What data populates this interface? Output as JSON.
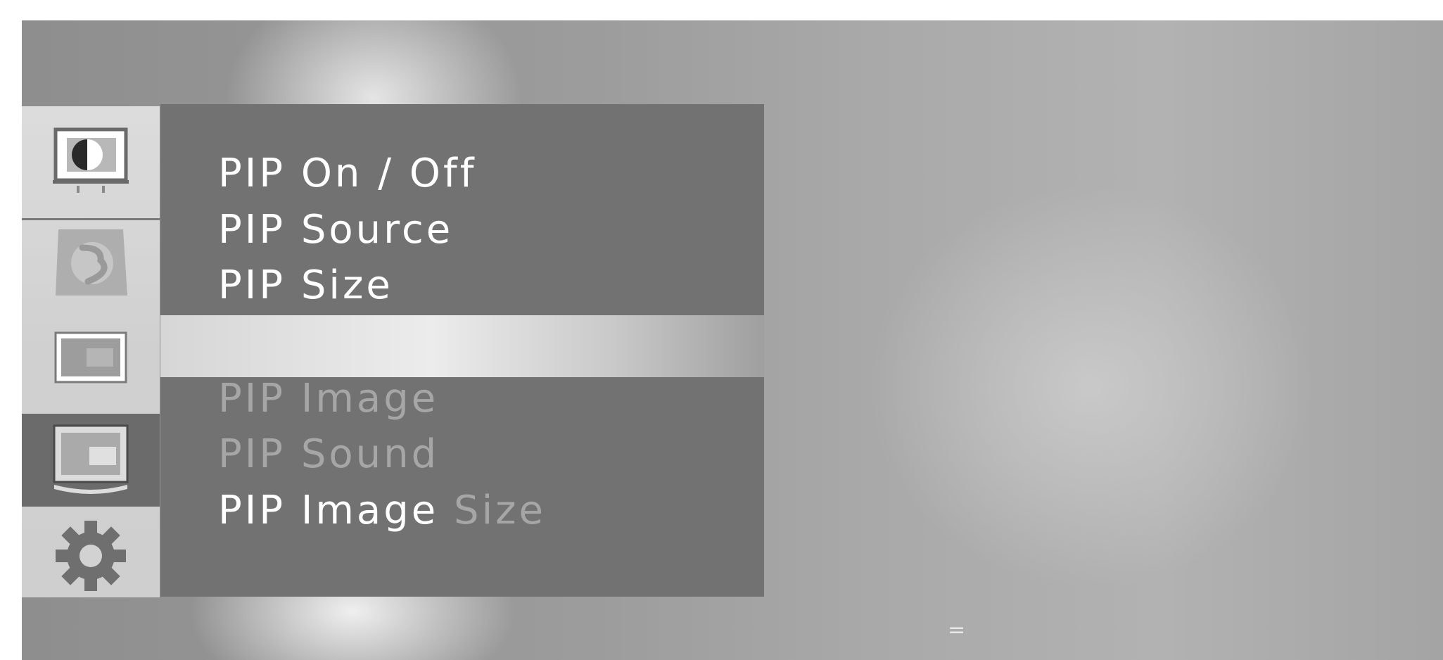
{
  "sidebar": {
    "items": [
      {
        "icon": "picture-monitor-icon",
        "active": false
      },
      {
        "icon": "audio-disc-icon",
        "active": false
      },
      {
        "icon": "time-screen-icon",
        "active": false
      },
      {
        "icon": "pip-monitor-icon",
        "active": true
      },
      {
        "icon": "gear-icon",
        "active": false
      }
    ]
  },
  "menu": {
    "items": [
      {
        "label": "PIP On / Off",
        "enabled": true
      },
      {
        "label": "PIP Source",
        "enabled": true
      },
      {
        "label": "PIP Size",
        "enabled": true
      },
      {
        "label": "PIP Image",
        "enabled": false
      },
      {
        "label": "PIP Sound",
        "enabled": false
      },
      {
        "label_main": "PIP Image",
        "label_dim": " Size",
        "enabled": "partial"
      }
    ]
  },
  "hint": "=",
  "colors": {
    "panel": "#727272",
    "active_sidebar": "#6b6b6b",
    "enabled_text": "#ffffff",
    "disabled_text": "#a6a6a6"
  }
}
